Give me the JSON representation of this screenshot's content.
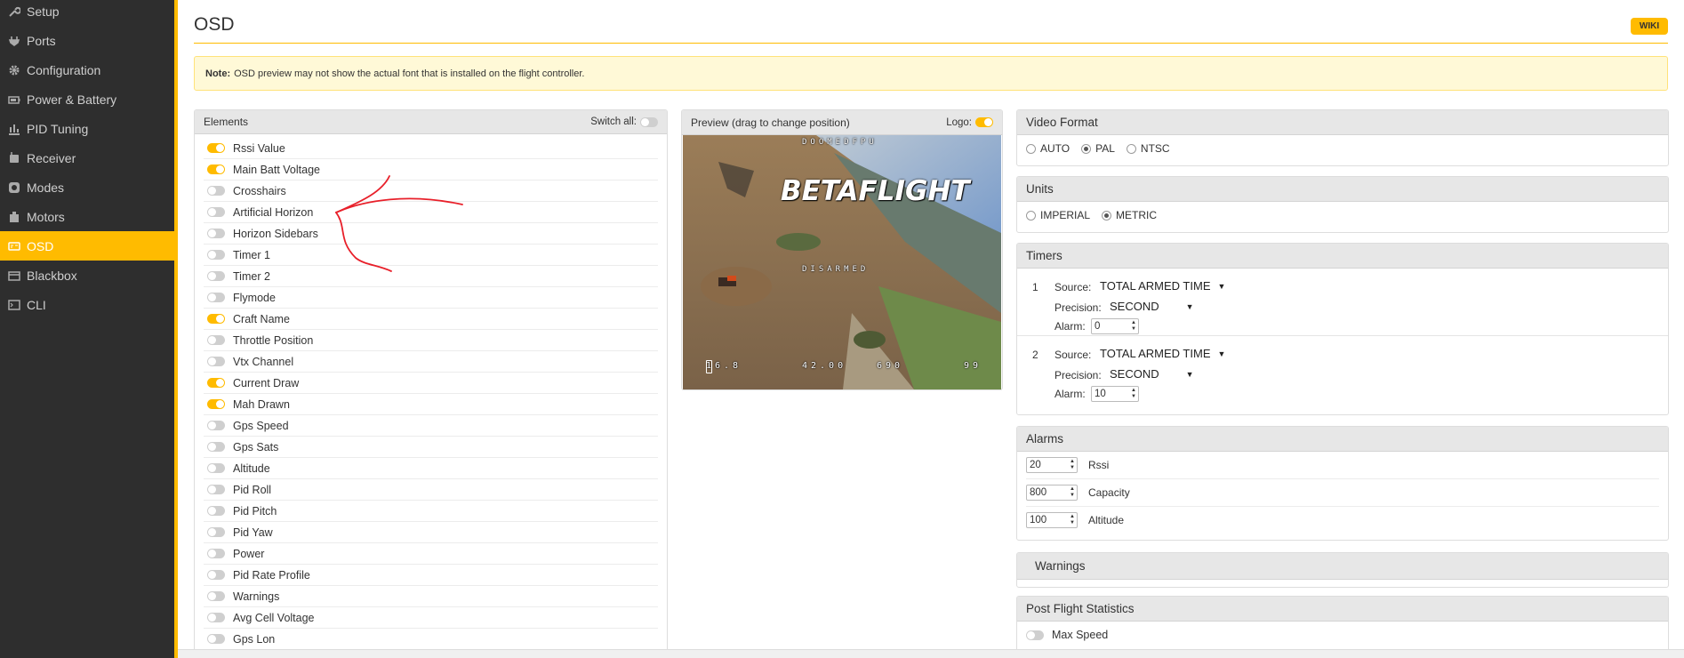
{
  "nav": {
    "items": [
      {
        "label": "Setup",
        "icon": "wrench-icon"
      },
      {
        "label": "Ports",
        "icon": "plug-icon"
      },
      {
        "label": "Configuration",
        "icon": "gear-icon"
      },
      {
        "label": "Power & Battery",
        "icon": "battery-icon"
      },
      {
        "label": "PID Tuning",
        "icon": "sliders-icon"
      },
      {
        "label": "Receiver",
        "icon": "receiver-icon"
      },
      {
        "label": "Modes",
        "icon": "modes-icon"
      },
      {
        "label": "Motors",
        "icon": "motor-icon"
      },
      {
        "label": "OSD",
        "icon": "osd-icon",
        "active": true
      },
      {
        "label": "Blackbox",
        "icon": "blackbox-icon"
      },
      {
        "label": "CLI",
        "icon": "cli-icon"
      }
    ],
    "accent": "#ffbb00"
  },
  "page": {
    "title": "OSD",
    "wiki_label": "WIKI",
    "note_bold": "Note:",
    "note_text": "OSD preview may not show the actual font that is installed on the flight controller."
  },
  "elements": {
    "title": "Elements",
    "switch_all_label": "Switch all:",
    "switch_all_on": false,
    "items": [
      {
        "label": "Rssi Value",
        "on": true
      },
      {
        "label": "Main Batt Voltage",
        "on": true
      },
      {
        "label": "Crosshairs",
        "on": false
      },
      {
        "label": "Artificial Horizon",
        "on": false
      },
      {
        "label": "Horizon Sidebars",
        "on": false
      },
      {
        "label": "Timer 1",
        "on": false
      },
      {
        "label": "Timer 2",
        "on": false
      },
      {
        "label": "Flymode",
        "on": false
      },
      {
        "label": "Craft Name",
        "on": true
      },
      {
        "label": "Throttle Position",
        "on": false
      },
      {
        "label": "Vtx Channel",
        "on": false
      },
      {
        "label": "Current Draw",
        "on": true
      },
      {
        "label": "Mah Drawn",
        "on": true
      },
      {
        "label": "Gps Speed",
        "on": false
      },
      {
        "label": "Gps Sats",
        "on": false
      },
      {
        "label": "Altitude",
        "on": false
      },
      {
        "label": "Pid Roll",
        "on": false
      },
      {
        "label": "Pid Pitch",
        "on": false
      },
      {
        "label": "Pid Yaw",
        "on": false
      },
      {
        "label": "Power",
        "on": false
      },
      {
        "label": "Pid Rate Profile",
        "on": false
      },
      {
        "label": "Warnings",
        "on": false
      },
      {
        "label": "Avg Cell Voltage",
        "on": false
      },
      {
        "label": "Gps Lon",
        "on": false
      }
    ]
  },
  "preview": {
    "title": "Preview (drag to change position)",
    "logo_label": "Logo:",
    "logo_on": true,
    "logo_text": "BETAFLIGHT",
    "osd_craft_name": "DOOMEDFPU",
    "osd_status": "DISARMED",
    "osd_voltage": "16.8",
    "osd_current": "42.00",
    "osd_mah": "690",
    "osd_rssi": "99"
  },
  "video_format": {
    "title": "Video Format",
    "options": [
      {
        "label": "AUTO",
        "checked": false
      },
      {
        "label": "PAL",
        "checked": true
      },
      {
        "label": "NTSC",
        "checked": false
      }
    ]
  },
  "units": {
    "title": "Units",
    "options": [
      {
        "label": "IMPERIAL",
        "checked": false
      },
      {
        "label": "METRIC",
        "checked": true
      }
    ]
  },
  "timers": {
    "title": "Timers",
    "source_label": "Source:",
    "precision_label": "Precision:",
    "alarm_label": "Alarm:",
    "items": [
      {
        "num": "1",
        "source": "TOTAL ARMED TIME",
        "precision": "SECOND",
        "alarm": "0"
      },
      {
        "num": "2",
        "source": "TOTAL ARMED TIME",
        "precision": "SECOND",
        "alarm": "10"
      }
    ]
  },
  "alarms": {
    "title": "Alarms",
    "items": [
      {
        "value": "20",
        "label": "Rssi"
      },
      {
        "value": "800",
        "label": "Capacity"
      },
      {
        "value": "100",
        "label": "Altitude"
      }
    ]
  },
  "warnings": {
    "title": "Warnings"
  },
  "post_flight": {
    "title": "Post Flight Statistics",
    "items": [
      {
        "label": "Max Speed",
        "on": false
      }
    ]
  }
}
